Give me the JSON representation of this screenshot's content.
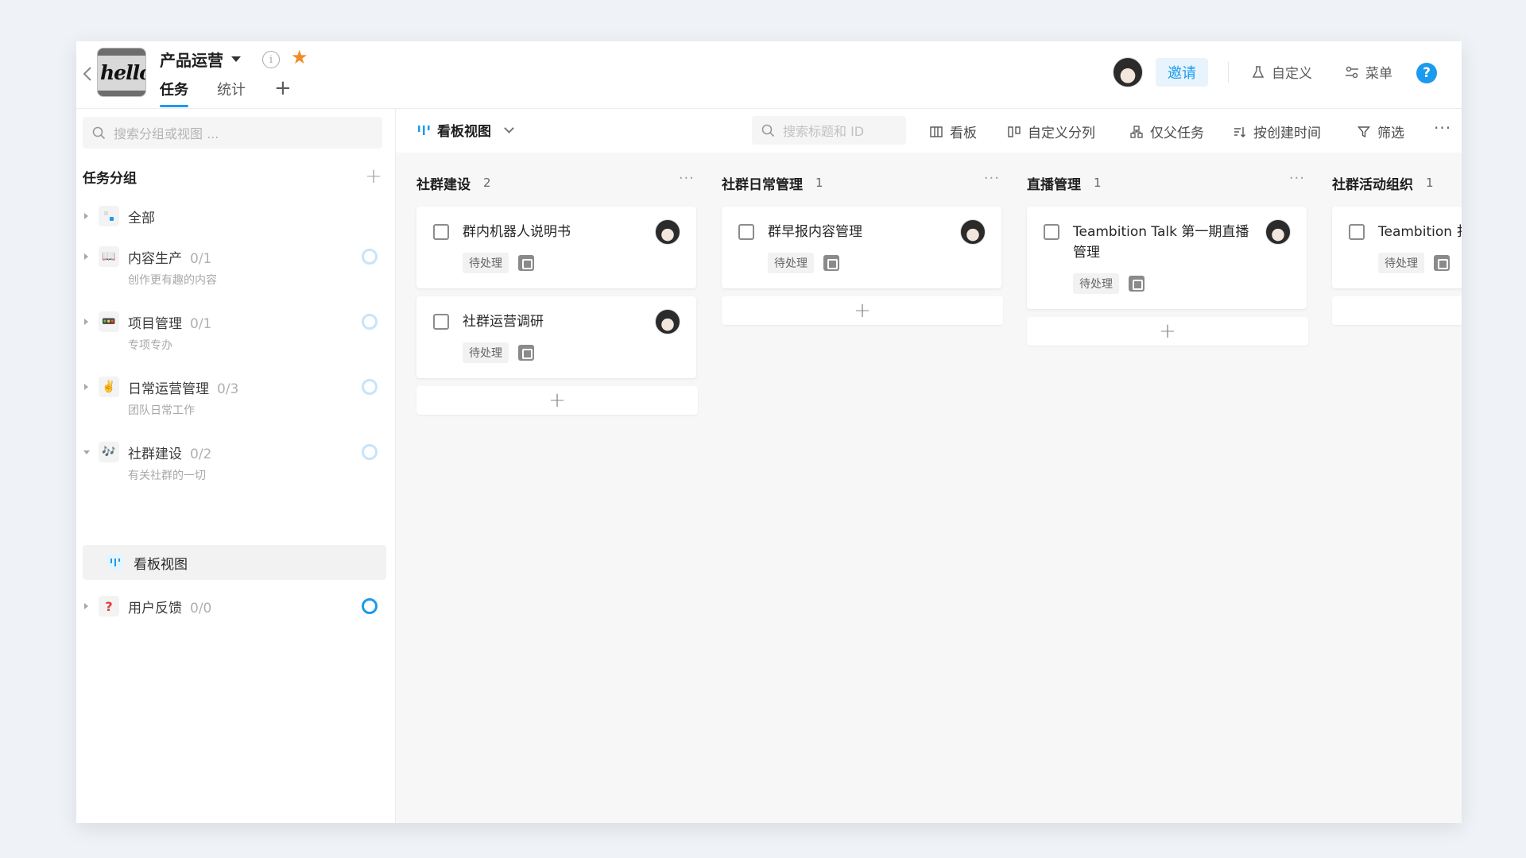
{
  "header": {
    "project_name": "产品运营",
    "logo_text": "hello",
    "tabs": [
      {
        "label": "任务"
      },
      {
        "label": "统计"
      }
    ],
    "add_tab": "+",
    "invite_label": "邀请",
    "customize_label": "自定义",
    "menu_label": "菜单",
    "help_icon": "?"
  },
  "sidebar": {
    "search_placeholder": "搜索分组或视图 ...",
    "section_title": "任务分组",
    "add": "+",
    "groups": [
      {
        "name": "全部",
        "count": "",
        "desc": "",
        "icon": "stack-icon"
      },
      {
        "name": "内容生产",
        "count": "0/1",
        "desc": "创作更有趣的内容",
        "icon": "📖"
      },
      {
        "name": "项目管理",
        "count": "0/1",
        "desc": "专项专办",
        "icon": "🚥"
      },
      {
        "name": "日常运营管理",
        "count": "0/3",
        "desc": "团队日常工作",
        "icon": "✌️"
      },
      {
        "name": "社群建设",
        "count": "0/2",
        "desc": "有关社群的一切",
        "icon": "🎶"
      },
      {
        "name": "用户反馈",
        "count": "0/0",
        "desc": "",
        "icon": "❓"
      }
    ],
    "active_view": "看板视图"
  },
  "toolbar": {
    "view_name": "看板视图",
    "search_placeholder": "搜索标题和 ID",
    "actions": [
      {
        "label": "看板",
        "icon": "board-icon"
      },
      {
        "label": "自定义分列",
        "icon": "columns-icon"
      },
      {
        "label": "仅父任务",
        "icon": "hierarchy-icon"
      },
      {
        "label": "按创建时间",
        "icon": "sort-icon"
      },
      {
        "label": "筛选",
        "icon": "filter-icon"
      }
    ],
    "more": "···"
  },
  "board": {
    "columns": [
      {
        "title": "社群建设",
        "count": "2",
        "cards": [
          {
            "title": "群内机器人说明书",
            "status": "待处理"
          },
          {
            "title": "社群运营调研",
            "status": "待处理"
          }
        ]
      },
      {
        "title": "社群日常管理",
        "count": "1",
        "cards": [
          {
            "title": "群早报内容管理",
            "status": "待处理"
          }
        ]
      },
      {
        "title": "直播管理",
        "count": "1",
        "cards": [
          {
            "title": "Teambition Talk 第一期直播管理",
            "status": "待处理"
          }
        ]
      },
      {
        "title": "社群活动组织",
        "count": "1",
        "cards": [
          {
            "title": "Teambition 扌",
            "status": "待处理"
          }
        ]
      }
    ],
    "more": "···",
    "add": "+"
  },
  "colors": {
    "accent": "#1b9aee",
    "star": "#f08a24",
    "ring": "#c6e4fb"
  }
}
